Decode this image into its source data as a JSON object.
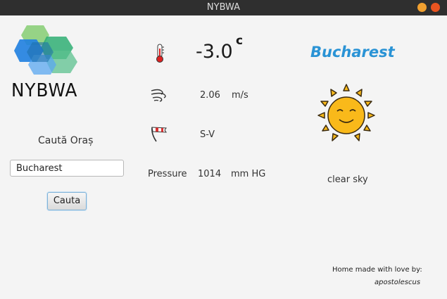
{
  "window": {
    "title": "NYBWA"
  },
  "logo": {
    "text": "NYBWA"
  },
  "search": {
    "label": "Caută Oraș",
    "input_value": "Bucharest",
    "button_label": "Cauta"
  },
  "weather": {
    "temperature": "-3.0",
    "temperature_unit": "c",
    "wind_speed": "2.06",
    "wind_unit": "m/s",
    "wind_direction": "S-V",
    "pressure_label": "Pressure",
    "pressure_value": "1014",
    "pressure_unit": "mm HG",
    "city": "Bucharest",
    "description": "clear sky"
  },
  "footer": {
    "line1": "Home made with love by:",
    "line2": "apostolescus"
  },
  "icons": [
    "thermometer-icon",
    "wind-icon",
    "wind-direction-icon",
    "sun-icon"
  ],
  "colors": {
    "titlebar": "#2f2f2f",
    "city": "#2a93d5",
    "sun": "#f9b91a"
  }
}
